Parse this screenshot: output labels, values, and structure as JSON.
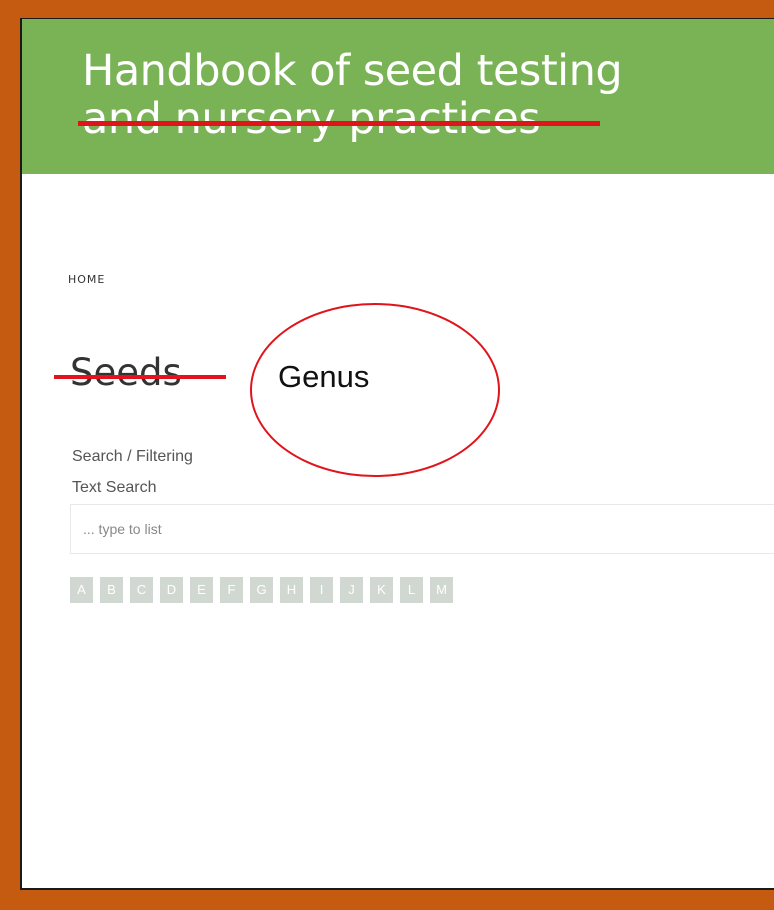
{
  "header": {
    "title_line1": "Handbook of seed testing",
    "title_line2": "and nursery practices",
    "background_color": "#7ab356"
  },
  "breadcrumb": {
    "home_label": "HOME"
  },
  "page": {
    "title": "Seeds"
  },
  "annotation": {
    "replacement_text": "Genus",
    "mark_color": "#e0141a"
  },
  "search": {
    "section_label": "Search / Filtering",
    "field_label": "Text Search",
    "placeholder": "... type to list",
    "value": ""
  },
  "alphabet": [
    "A",
    "B",
    "C",
    "D",
    "E",
    "F",
    "G",
    "H",
    "I",
    "J",
    "K",
    "L",
    "M"
  ],
  "colors": {
    "frame": "#c55a11",
    "letter_button": "#d1d8d1"
  }
}
